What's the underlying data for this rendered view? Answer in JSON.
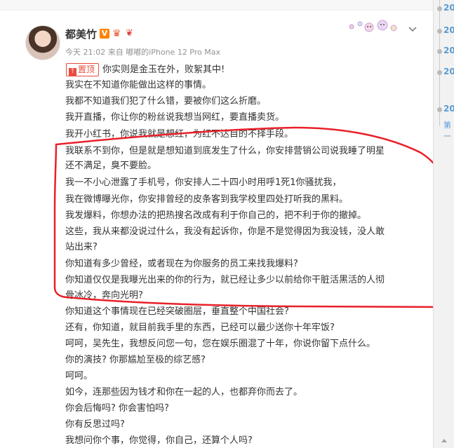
{
  "post": {
    "username": "都美竹",
    "v_badge": "V",
    "meta": "今天 21:02 来自 嘟嘟的iPhone 12 Pro Max",
    "pin_label": "置顶",
    "lines": [
      "你实则是金玉在外，败絮其中!",
      "我实在不知道你能做出这样的事情。",
      "我都不知道我们犯了什么错，要被你们这么折磨。",
      "我开直播，你让你的粉丝说我想当网红，要直播卖货。",
      "我开小红书，你说我就是想红，为红不达目的不择手段。",
      "我联系不到你，但是就是想知道到底发生了什么，你安排营销公司说我睡了明星",
      "还不满足，臭不要脸。",
      "我一不小心泄露了手机号，你安排人二十四小时用呼1死1你骚扰我，",
      "我在微博曝光你，你安排曾经的皮条客到我学校里四处打听我的黑料。",
      "我发爆料，你想办法的把热搜名改成有利于你自己的，把不利于你的撤掉。",
      "这些，我从来都没说过什么，我没有起诉你，你是不是觉得因为我没钱，没人敢",
      "站出来?",
      "你知道有多少曾经，或者现在为你服务的员工来找我爆料?",
      "你知道仅仅是我曝光出来的你的行为，就已经让多少以前给你干脏活黑活的人彻",
      "骨冰冷，奔向光明?",
      "你知道这个事情现在已经突破圈层，垂直整个中国社会?",
      "还有，你知道，就目前我手里的东西，已经可以最少送你十年牢饭?",
      "呵呵，吴先生，我想反问您一句，您在娱乐圈混了十年，你说你留下点什么。",
      "你的演技? 你那尴尬至极的综艺感?",
      "呵呵。",
      "如今，连那些因为钱才和你在一起的人，也都弃你而去了。",
      "你会后悔吗? 你会害怕吗?",
      "你有反思过吗?",
      "我想问你个事，你觉得，你自己，还算个人吗?"
    ]
  },
  "timeline": {
    "years": [
      "20",
      "20",
      "20",
      "20",
      "20"
    ],
    "more": "第一"
  },
  "colors": {
    "annotation": "#e8202a",
    "accent": "#ff8200",
    "pin": "#e94c3d",
    "link_year": "#5a9bd5"
  },
  "icons": [
    "avatar",
    "v-badge-icon",
    "fan-badge-icon",
    "decoration-icon",
    "chevron-down-icon",
    "pin-icon",
    "scroll-down-icon"
  ]
}
